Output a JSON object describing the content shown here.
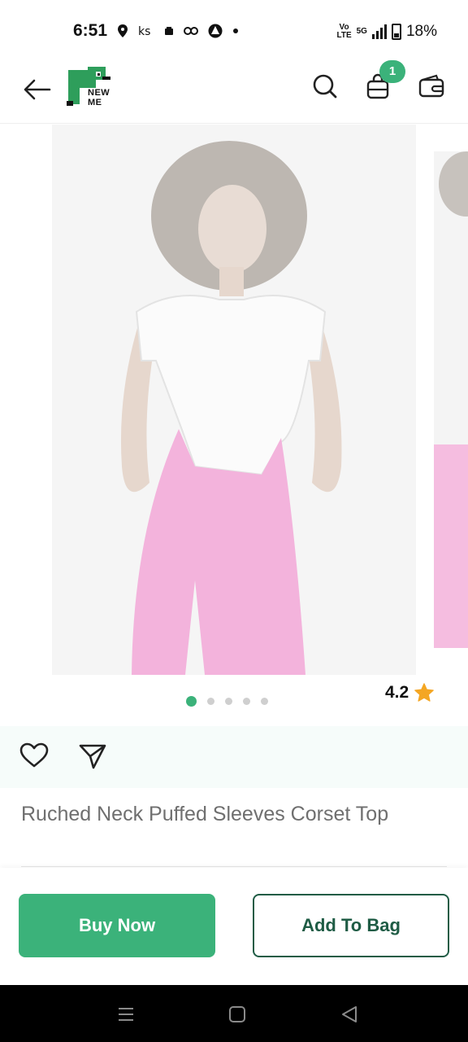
{
  "status_bar": {
    "time": "6:51",
    "left_icons": [
      "location-icon",
      "network-speed-icon",
      "notification-icon",
      "link-icon",
      "app-icon",
      "dot-icon"
    ],
    "network_label_top": "Vo",
    "network_label_bottom": "LTE",
    "five_g": "5G",
    "battery_percent": "18%"
  },
  "header": {
    "logo_text_line1": "NEW",
    "logo_text_line2": "ME",
    "bag_count": "1",
    "accent_color": "#3bb27a"
  },
  "gallery": {
    "image_count": 5,
    "active_index": 0,
    "rating": "4.2",
    "star_color": "#f4a623"
  },
  "product": {
    "title": "Ruched Neck Puffed Sleeves Corset Top"
  },
  "cta": {
    "buy_now": "Buy Now",
    "add_to_bag": "Add To Bag",
    "buy_color": "#3bb27a",
    "add_border_color": "#1f5c45"
  },
  "system_nav": {
    "keys": [
      "menu-icon",
      "home-icon",
      "back-triangle-icon"
    ]
  }
}
